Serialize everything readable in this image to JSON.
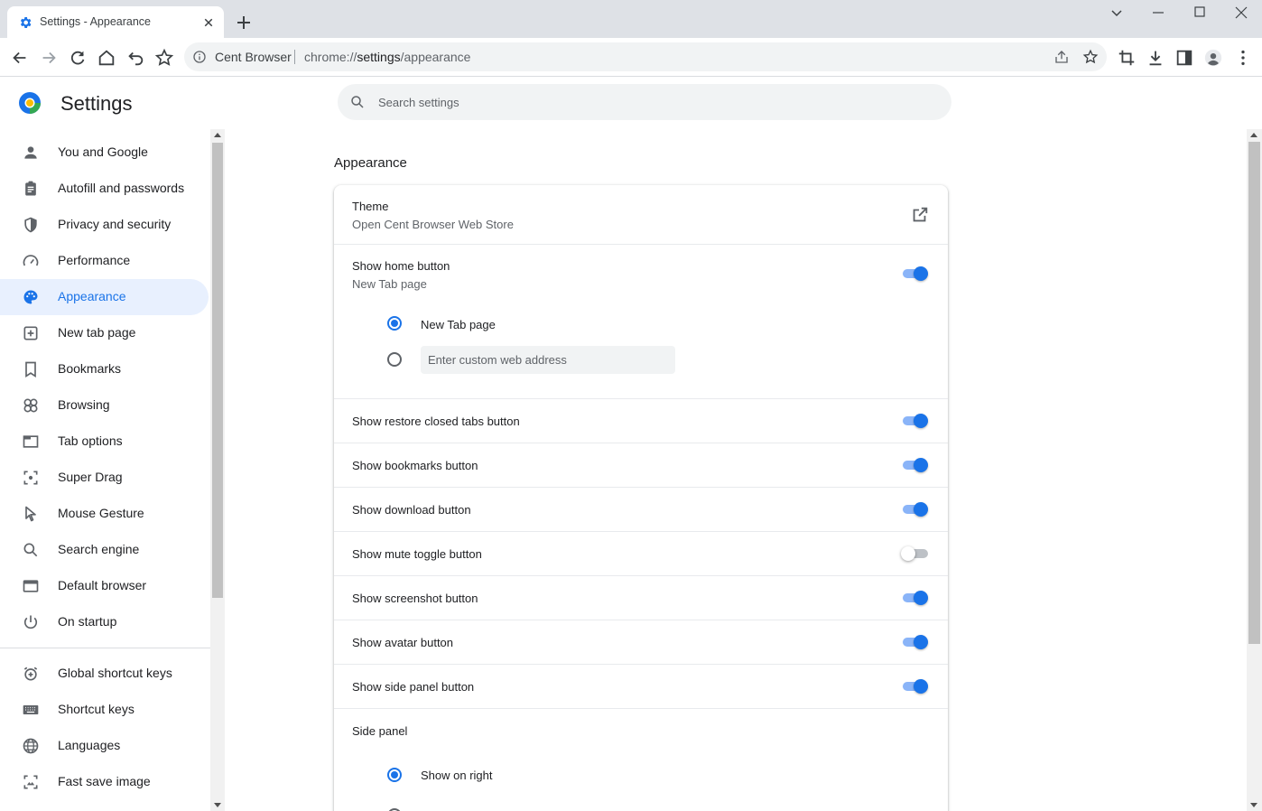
{
  "browser": {
    "tab_title": "Settings - Appearance",
    "omnibox_site": "Cent Browser",
    "url_scheme": "chrome://",
    "url_host": "settings",
    "url_path": "/appearance",
    "accent_color": "#1a73e8"
  },
  "header": {
    "title": "Settings",
    "search_placeholder": "Search settings"
  },
  "sidebar": {
    "items": [
      {
        "label": "You and Google",
        "icon": "person-icon"
      },
      {
        "label": "Autofill and passwords",
        "icon": "clipboard-icon"
      },
      {
        "label": "Privacy and security",
        "icon": "shield-icon"
      },
      {
        "label": "Performance",
        "icon": "speedometer-icon"
      },
      {
        "label": "Appearance",
        "icon": "palette-icon",
        "selected": true
      },
      {
        "label": "New tab page",
        "icon": "new-tab-icon"
      },
      {
        "label": "Bookmarks",
        "icon": "bookmark-icon"
      },
      {
        "label": "Browsing",
        "icon": "browsing-icon"
      },
      {
        "label": "Tab options",
        "icon": "tab-icon"
      },
      {
        "label": "Super Drag",
        "icon": "drag-icon"
      },
      {
        "label": "Mouse Gesture",
        "icon": "cursor-icon"
      },
      {
        "label": "Search engine",
        "icon": "search-icon"
      },
      {
        "label": "Default browser",
        "icon": "browser-window-icon"
      },
      {
        "label": "On startup",
        "icon": "power-icon"
      },
      {
        "label": "Global shortcut keys",
        "icon": "alarm-icon"
      },
      {
        "label": "Shortcut keys",
        "icon": "keyboard-icon"
      },
      {
        "label": "Languages",
        "icon": "globe-icon"
      },
      {
        "label": "Fast save image",
        "icon": "image-save-icon"
      }
    ]
  },
  "appearance": {
    "section_title": "Appearance",
    "theme": {
      "label": "Theme",
      "sublabel": "Open Cent Browser Web Store"
    },
    "home_button": {
      "label": "Show home button",
      "sublabel": "New Tab page",
      "enabled": true,
      "option_new_tab": "New Tab page",
      "custom_placeholder": "Enter custom web address"
    },
    "toggles": [
      {
        "label": "Show restore closed tabs button",
        "enabled": true
      },
      {
        "label": "Show bookmarks button",
        "enabled": true
      },
      {
        "label": "Show download button",
        "enabled": true
      },
      {
        "label": "Show mute toggle button",
        "enabled": false
      },
      {
        "label": "Show screenshot button",
        "enabled": true
      },
      {
        "label": "Show avatar button",
        "enabled": true
      },
      {
        "label": "Show side panel button",
        "enabled": true
      }
    ],
    "side_panel": {
      "label": "Side panel",
      "option_right": "Show on right"
    }
  }
}
